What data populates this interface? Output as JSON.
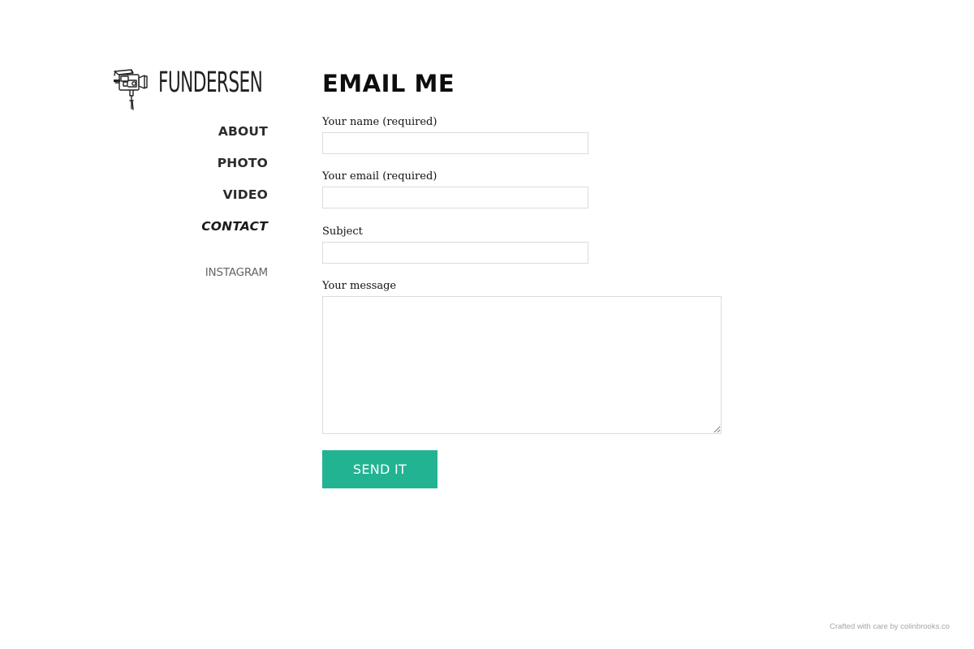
{
  "brand": {
    "name": "FUNDERSEN",
    "logo_icon": "vintage-film-camera-icon"
  },
  "nav": {
    "items": [
      {
        "label": "ABOUT"
      },
      {
        "label": "PHOTO"
      },
      {
        "label": "VIDEO"
      },
      {
        "label": "CONTACT",
        "active": true
      }
    ],
    "social_label": "INSTAGRAM"
  },
  "page": {
    "title": "EMAIL ME"
  },
  "form": {
    "name_label": "Your name (required)",
    "name_value": "",
    "email_label": "Your email (required)",
    "email_value": "",
    "subject_label": "Subject",
    "subject_value": "",
    "message_label": "Your message",
    "message_value": "",
    "submit_label": "SEND IT"
  },
  "footer": {
    "credit": "Crafted with care by colinbrooks.co"
  },
  "colors": {
    "accent": "#22b393",
    "text": "#1a1a1a",
    "muted": "#666666",
    "border": "#dcdcdc",
    "footer": "#a5a5a5"
  }
}
